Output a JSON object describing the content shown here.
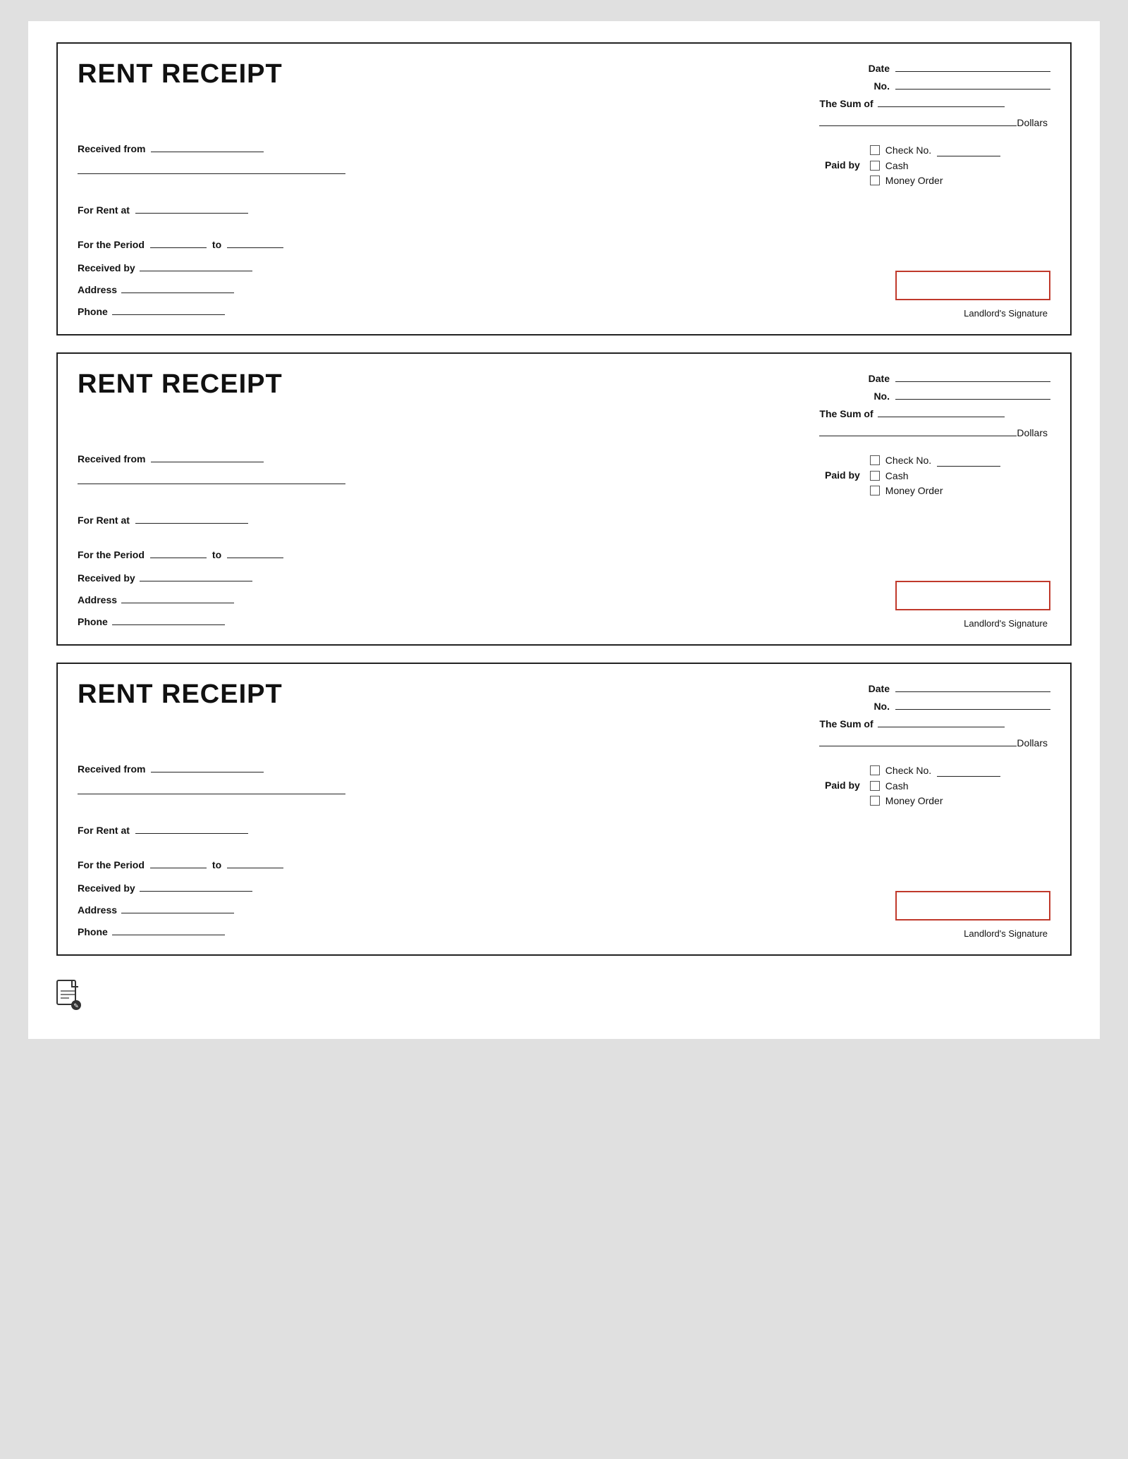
{
  "receipts": [
    {
      "id": "receipt-1",
      "title": "RENT RECEIPT",
      "date_label": "Date",
      "no_label": "No.",
      "sum_label": "The Sum of",
      "dollars_label": "Dollars",
      "received_from_label": "Received from",
      "for_rent_at_label": "For Rent at",
      "for_the_period_label": "For the Period",
      "to_label": "to",
      "received_by_label": "Received by",
      "address_label": "Address",
      "phone_label": "Phone",
      "paid_by_label": "Paid by",
      "check_no_label": "Check No.",
      "cash_label": "Cash",
      "money_order_label": "Money Order",
      "landlord_sig_label": "Landlord's Signature"
    },
    {
      "id": "receipt-2",
      "title": "RENT RECEIPT",
      "date_label": "Date",
      "no_label": "No.",
      "sum_label": "The Sum of",
      "dollars_label": "Dollars",
      "received_from_label": "Received from",
      "for_rent_at_label": "For Rent at",
      "for_the_period_label": "For the Period",
      "to_label": "to",
      "received_by_label": "Received by",
      "address_label": "Address",
      "phone_label": "Phone",
      "paid_by_label": "Paid by",
      "check_no_label": "Check No.",
      "cash_label": "Cash",
      "money_order_label": "Money Order",
      "landlord_sig_label": "Landlord's Signature"
    },
    {
      "id": "receipt-3",
      "title": "RENT RECEIPT",
      "date_label": "Date",
      "no_label": "No.",
      "sum_label": "The Sum of",
      "dollars_label": "Dollars",
      "received_from_label": "Received from",
      "for_rent_at_label": "For Rent at",
      "for_the_period_label": "For the Period",
      "to_label": "to",
      "received_by_label": "Received by",
      "address_label": "Address",
      "phone_label": "Phone",
      "paid_by_label": "Paid by",
      "check_no_label": "Check No.",
      "cash_label": "Cash",
      "money_order_label": "Money Order",
      "landlord_sig_label": "Landlord's Signature"
    }
  ],
  "footer": {
    "doc_icon_title": "document icon"
  }
}
